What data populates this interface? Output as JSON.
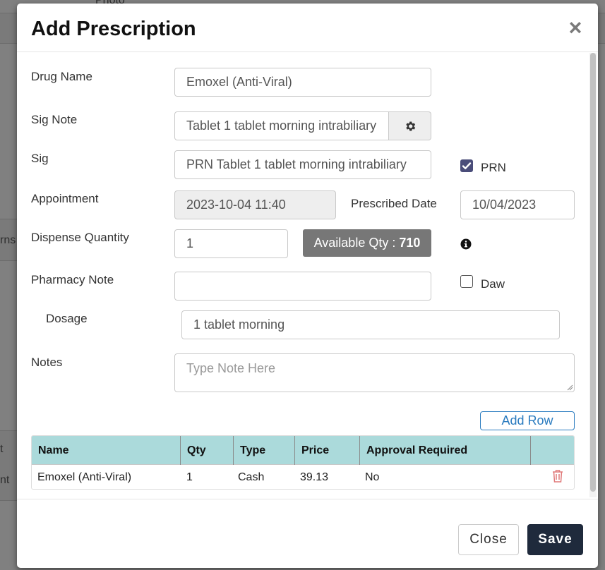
{
  "background": {
    "text_top": "Photo",
    "text_left_mid": "rns",
    "text_left_row1": "t",
    "text_left_row2": "nt"
  },
  "modal": {
    "title": "Add Prescription",
    "close_icon": "×"
  },
  "form": {
    "drug_name": {
      "label": "Drug Name",
      "value": "Emoxel (Anti-Viral)"
    },
    "sig_note": {
      "label": "Sig Note",
      "value": "Tablet 1 tablet morning  intrabiliary",
      "icon": "gear-icon"
    },
    "sig": {
      "label": "Sig",
      "value": "PRN Tablet 1 tablet morning  intrabiliary"
    },
    "prn": {
      "label": "PRN",
      "checked": true
    },
    "appointment": {
      "label": "Appointment",
      "value": "2023-10-04 11:40"
    },
    "prescribed_date": {
      "label": "Prescribed Date",
      "value": "10/04/2023"
    },
    "dispense_quantity": {
      "label": "Dispense Quantity",
      "value": "1"
    },
    "available_qty": {
      "label": "Available Qty :",
      "value": "710",
      "info_icon": "info-icon"
    },
    "pharmacy_note": {
      "label": "Pharmacy Note",
      "value": ""
    },
    "daw": {
      "label": "Daw",
      "checked": false
    },
    "dosage": {
      "label": "Dosage",
      "value": "1 tablet morning"
    },
    "notes": {
      "label": "Notes",
      "placeholder": "Type Note Here",
      "value": ""
    }
  },
  "add_row_label": "Add Row",
  "table": {
    "headers": [
      "Name",
      "Qty",
      "Type",
      "Price",
      "Approval Required",
      ""
    ],
    "rows": [
      [
        "Emoxel (Anti-Viral)",
        "1",
        "Cash",
        "39.13",
        "No"
      ]
    ],
    "delete_icon": "trash-icon"
  },
  "footer": {
    "close_label": "Close",
    "save_label": "Save"
  },
  "colors": {
    "table_header": "#abdadb",
    "save_button": "#1f2a3c",
    "add_row_accent": "#2a7bbf",
    "checkbox_checked": "#4a4d7a",
    "delete_icon": "#e07a7a",
    "badge": "#777777"
  }
}
